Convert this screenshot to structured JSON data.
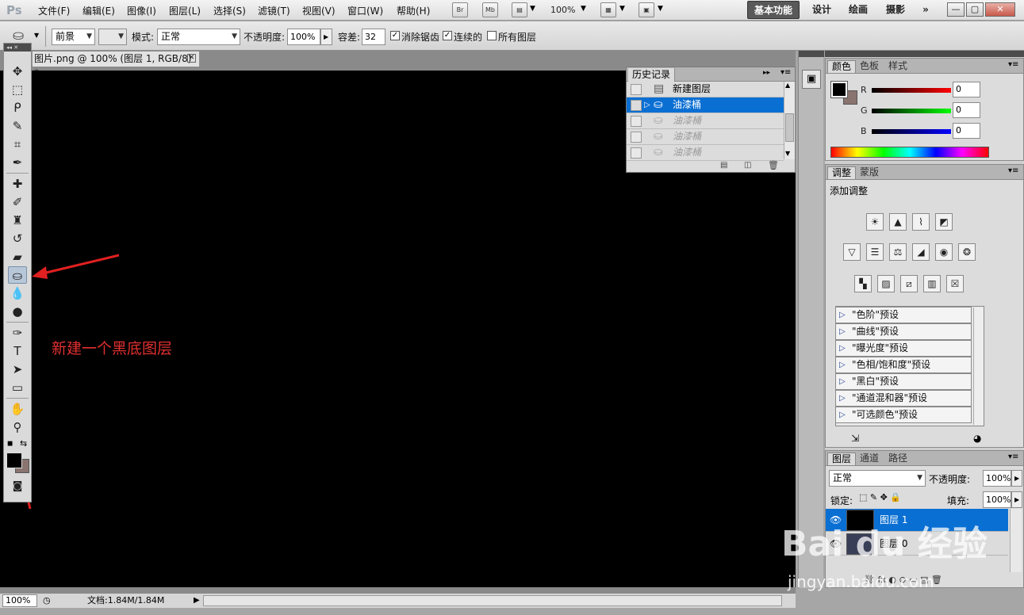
{
  "app": {
    "logo": "Ps"
  },
  "menu": [
    "文件(F)",
    "编辑(E)",
    "图像(I)",
    "图层(L)",
    "选择(S)",
    "滤镜(T)",
    "视图(V)",
    "窗口(W)",
    "帮助(H)"
  ],
  "appbar": {
    "br": "Br",
    "mb": "Mb",
    "zoom": "100%"
  },
  "workspaces": [
    "基本功能",
    "设计",
    "绘画",
    "摄影",
    "»"
  ],
  "options": {
    "fill_source": "前景",
    "mode_label": "模式:",
    "mode_value": "正常",
    "opacity_label": "不透明度:",
    "opacity_value": "100%",
    "tolerance_label": "容差:",
    "tolerance_value": "32",
    "antialias_label": "消除锯齿",
    "contiguous_label": "连续的",
    "all_layers_label": "所有图层"
  },
  "document": {
    "tab_title": "图片.png @ 100% (图层 1, RGB/8) *"
  },
  "annotation": "新建一个黑底图层",
  "history": {
    "title": "历史记录",
    "rows": [
      {
        "label": "新建图层",
        "state": "normal"
      },
      {
        "label": "油漆桶",
        "state": "selected"
      },
      {
        "label": "油漆桶",
        "state": "dim"
      },
      {
        "label": "油漆桶",
        "state": "dim"
      },
      {
        "label": "油漆桶",
        "state": "dim"
      }
    ]
  },
  "color_panel": {
    "tabs": [
      "颜色",
      "色板",
      "样式"
    ],
    "r_label": "R",
    "g_label": "G",
    "b_label": "B",
    "r": "0",
    "g": "0",
    "b": "0"
  },
  "adjust_panel": {
    "tabs": [
      "调整",
      "蒙版"
    ],
    "heading": "添加调整",
    "presets": [
      "\"色阶\"预设",
      "\"曲线\"预设",
      "\"曝光度\"预设",
      "\"色相/饱和度\"预设",
      "\"黑白\"预设",
      "\"通道混和器\"预设",
      "\"可选颜色\"预设"
    ]
  },
  "layers_panel": {
    "tabs": [
      "图层",
      "通道",
      "路径"
    ],
    "blend_mode": "正常",
    "opacity_label": "不透明度:",
    "opacity": "100%",
    "lock_label": "锁定:",
    "fill_label": "填充:",
    "fill": "100%",
    "layers": [
      {
        "name": "图层 1",
        "selected": true
      },
      {
        "name": "图层 0",
        "selected": false
      }
    ]
  },
  "status": {
    "zoom": "100%",
    "doc_info": "文档:1.84M/1.84M"
  },
  "watermark": {
    "logo": "Bai du 经验",
    "url": "jingyan.baidu.com"
  },
  "colors": {
    "accent_blue": "#0a6fd3",
    "annotation_red": "#e03030",
    "canvas": "#000000"
  }
}
